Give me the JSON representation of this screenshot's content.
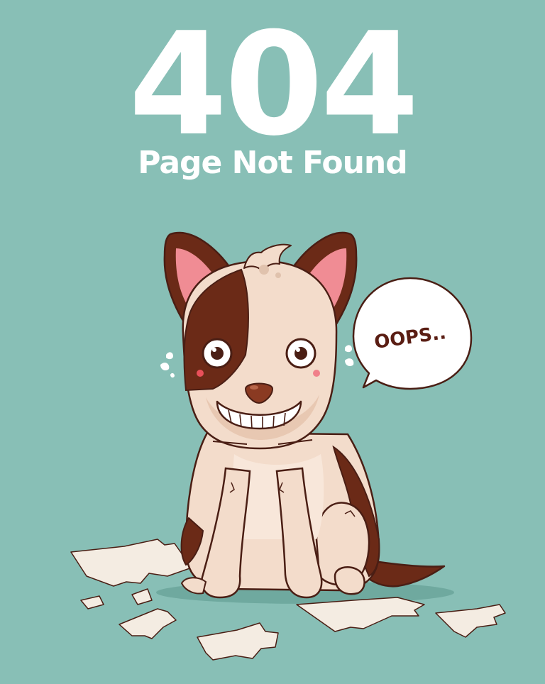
{
  "error": {
    "code": "404",
    "message": "Page Not Found"
  },
  "speech_bubble": {
    "text": "OOPS.."
  },
  "icons": [
    "puppy-illustration",
    "speech-bubble",
    "torn-paper-scraps",
    "sweat-drops"
  ],
  "colors": {
    "background": "#88bfb6",
    "text": "#ffffff",
    "dog_fur": "#f3dccb",
    "dog_spot": "#6b2a17",
    "outline": "#4a1e14",
    "ear_inner": "#f08c94",
    "paper": "#f4ece2"
  }
}
